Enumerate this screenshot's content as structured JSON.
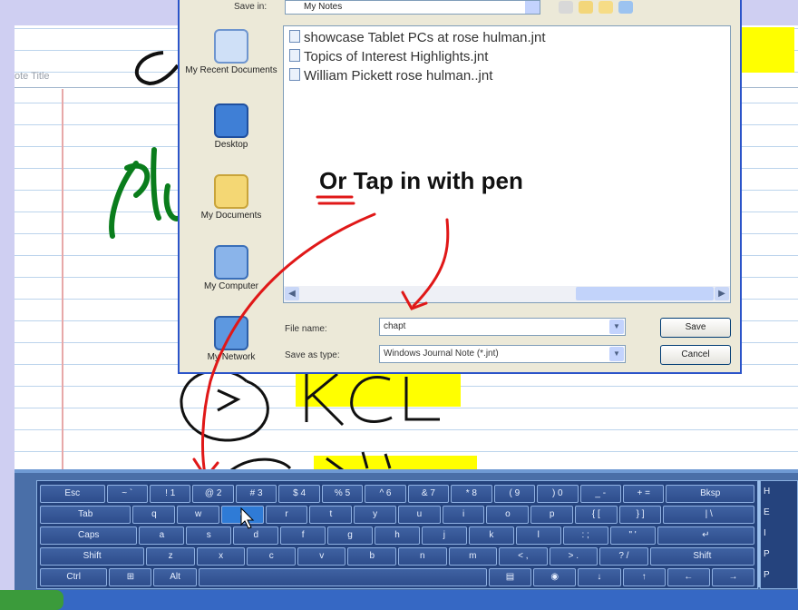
{
  "journal": {
    "note_title": "ote Title"
  },
  "dialog": {
    "save_in_label": "Save in:",
    "save_in_value": "My Notes",
    "places": [
      {
        "label": "My Recent Documents",
        "icon": "recent-documents-icon"
      },
      {
        "label": "Desktop",
        "icon": "desktop-icon"
      },
      {
        "label": "My Documents",
        "icon": "my-documents-icon"
      },
      {
        "label": "My Computer",
        "icon": "my-computer-icon"
      },
      {
        "label": "My Network",
        "icon": "my-network-icon"
      }
    ],
    "files": [
      "showcase  Tablet PCs at rose hulman.jnt",
      "Topics of Interest Highlights.jnt",
      "William Pickett rose hulman..jnt"
    ],
    "file_name_label": "File name:",
    "file_name_value": "chapt",
    "save_as_type_label": "Save as type:",
    "save_as_type_value": "Windows Journal Note (*.jnt)",
    "save_button": "Save",
    "cancel_button": "Cancel"
  },
  "annotation": {
    "text": "Or Tap in with pen"
  },
  "keyboard": {
    "rows": [
      [
        "Esc",
        "~ `",
        "! 1",
        "@ 2",
        "# 3",
        "$ 4",
        "% 5",
        "^ 6",
        "& 7",
        "* 8",
        "( 9",
        ") 0",
        "_ -",
        "+ =",
        "Bksp"
      ],
      [
        "Tab",
        "q",
        "w",
        "e",
        "r",
        "t",
        "y",
        "u",
        "i",
        "o",
        "p",
        "{ [",
        "} ]",
        "| \\"
      ],
      [
        "Caps",
        "a",
        "s",
        "d",
        "f",
        "g",
        "h",
        "j",
        "k",
        "l",
        ": ;",
        "\" '",
        "↵"
      ],
      [
        "Shift",
        "z",
        "x",
        "c",
        "v",
        "b",
        "n",
        "m",
        "< ,",
        "> .",
        "? /",
        "Shift"
      ],
      [
        "Ctrl",
        "⊞",
        "Alt",
        "",
        "▤",
        "◉",
        "↓",
        "↑",
        "←",
        "→"
      ]
    ],
    "right_keys": [
      "H",
      "E",
      "I",
      "P",
      "P"
    ]
  },
  "colors": {
    "highlighter": "#ffff00",
    "ink_green": "#0a7d1c",
    "ink_red": "#e01818",
    "dialog_border": "#2b54c9"
  }
}
